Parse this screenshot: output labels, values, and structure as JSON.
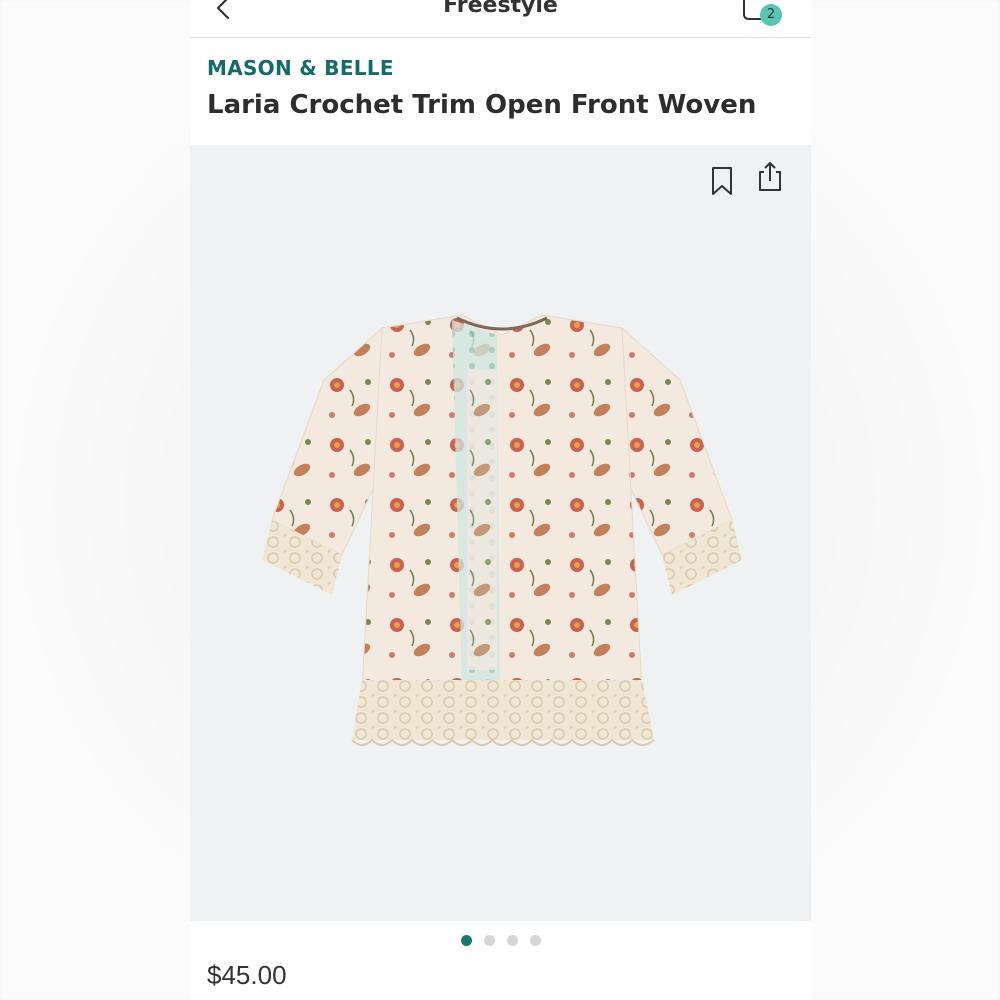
{
  "header": {
    "title": "Freestyle",
    "back_icon": "chevron-left-icon",
    "cart_icon": "shopping-bag-icon",
    "cart_count": "2"
  },
  "product": {
    "brand": "MASON & BELLE",
    "name": "Laria Crochet Trim Open Front Woven",
    "price": "$45.00",
    "image": "floral-kimono-cardigan-with-crochet-trim"
  },
  "gallery": {
    "save_icon": "bookmark-icon",
    "share_icon": "share-icon",
    "dots": {
      "count": 4,
      "active_index": 0
    }
  },
  "colors": {
    "brand_teal": "#146c6a",
    "badge_teal": "#5bc5b3",
    "active_dot": "#1a7670",
    "inactive_dot": "#d6d6d6",
    "gallery_bg": "#eff1f2"
  }
}
